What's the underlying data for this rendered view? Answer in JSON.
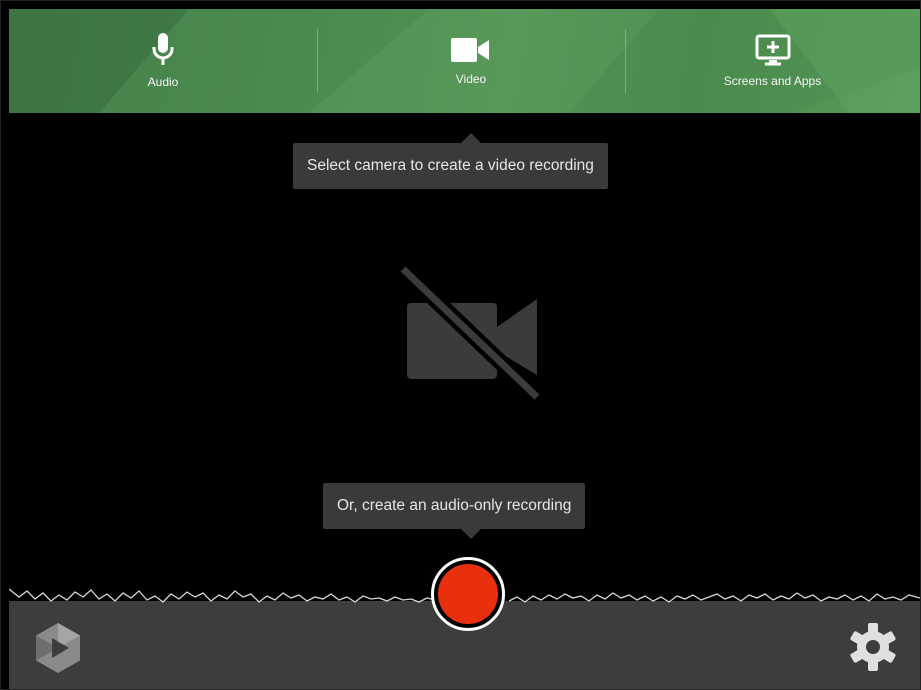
{
  "sources": {
    "audio": {
      "label": "Audio",
      "icon": "microphone-icon"
    },
    "video": {
      "label": "Video",
      "icon": "video-camera-icon"
    },
    "screens": {
      "label": "Screens and Apps",
      "icon": "monitor-plus-icon"
    }
  },
  "tooltips": {
    "camera_hint": "Select camera to create a video recording",
    "audio_hint": "Or, create an audio-only recording"
  },
  "preview": {
    "icon": "camera-off-icon"
  },
  "controls": {
    "record_icon": "record-icon",
    "logo_icon": "app-logo-icon",
    "settings_icon": "gear-icon"
  },
  "colors": {
    "source_bar": "#4c8a50",
    "record": "#e8300f",
    "tooltip_bg": "#3a3a3a",
    "bottom_bar": "#3d3d3d"
  }
}
